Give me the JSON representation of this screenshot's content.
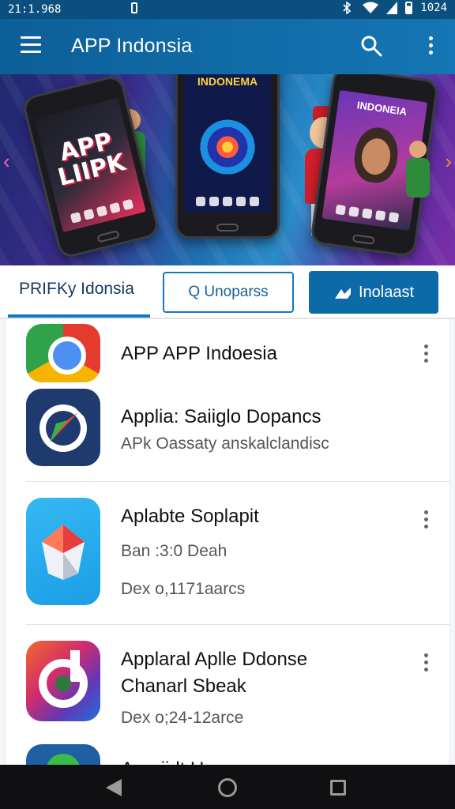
{
  "status_bar": {
    "time": "21:1.968",
    "clock_right": "1024"
  },
  "app_bar": {
    "title": "APP Indonsia"
  },
  "banner": {
    "phone1_text": "APP LIIPK",
    "phone2_text": "INDONEMA",
    "phone3_text": "INDONEIA"
  },
  "tabs": {
    "active_tab": "PRIFKy Idonsia",
    "search_button": "Q Unoparss",
    "install_button": "Inolaast"
  },
  "apps": [
    {
      "title": "APP APP Indoesia",
      "subtitle": "",
      "icon": "chrome-icon"
    },
    {
      "title": "Applia: Saiiglo Dopancs",
      "subtitle": "APk Oassaty anskalclandisc",
      "icon": "compass-icon"
    },
    {
      "title": "Aplabte Soplapit",
      "subtitle": "Ban :3:0 Deah",
      "subtitle2": "Dex o,1171aarcs",
      "icon": "star-icon"
    },
    {
      "title": "Applaral Aplle Ddonse",
      "subtitle": "Chanarl Sbeak",
      "subtitle2": "Dex o;24-12arce",
      "icon": "gradient-app-icon"
    },
    {
      "title": "Appriidt Uoe ...",
      "icon": "green-app-icon"
    }
  ],
  "colors": {
    "primary": "#0d6aa8",
    "app_bar": "#1476b4",
    "nav_bar": "#101012"
  }
}
